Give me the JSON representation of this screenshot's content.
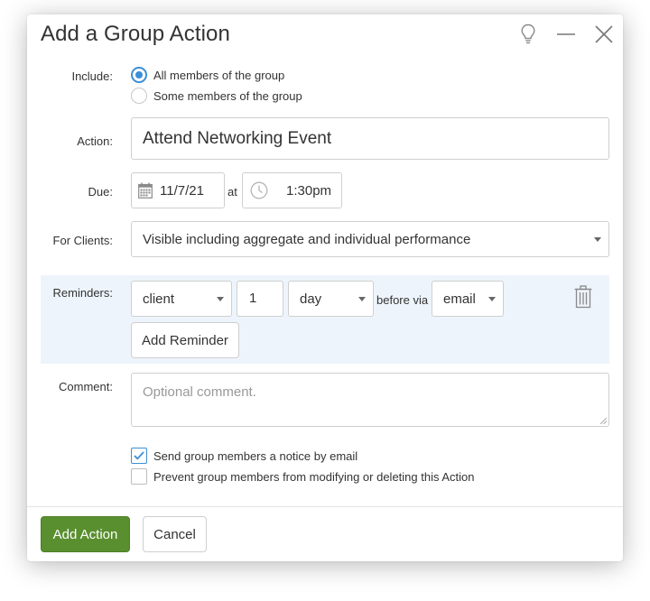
{
  "dialog": {
    "title": "Add a Group Action",
    "icons": [
      "lightbulb-icon",
      "minimize-icon",
      "close-icon"
    ]
  },
  "form": {
    "include": {
      "label": "Include:",
      "options": [
        "All members of the group",
        "Some members of the group"
      ],
      "selected": "All members of the group"
    },
    "action": {
      "label": "Action:",
      "value": "Attend Networking Event"
    },
    "due": {
      "label": "Due:",
      "date": "11/7/21",
      "at": "at",
      "time": "1:30pm"
    },
    "for_clients": {
      "label": "For Clients:",
      "value": "Visible including aggregate and individual performance"
    },
    "reminders": {
      "label": "Reminders:",
      "recipient": "client",
      "amount": "1",
      "unit": "day",
      "before_via": "before via",
      "channel": "email",
      "add_label": "Add Reminder"
    },
    "comment": {
      "label": "Comment:",
      "placeholder": "Optional comment."
    },
    "checkboxes": [
      {
        "label": "Send group members a notice by email",
        "checked": true
      },
      {
        "label": "Prevent group members from modifying or deleting this Action",
        "checked": false
      }
    ]
  },
  "footer": {
    "primary_label": "Add Action",
    "cancel_label": "Cancel"
  },
  "colors": {
    "accent": "#3b8fd6",
    "primary_button": "#5a8f2f",
    "reminder_band": "#edf4fb"
  }
}
